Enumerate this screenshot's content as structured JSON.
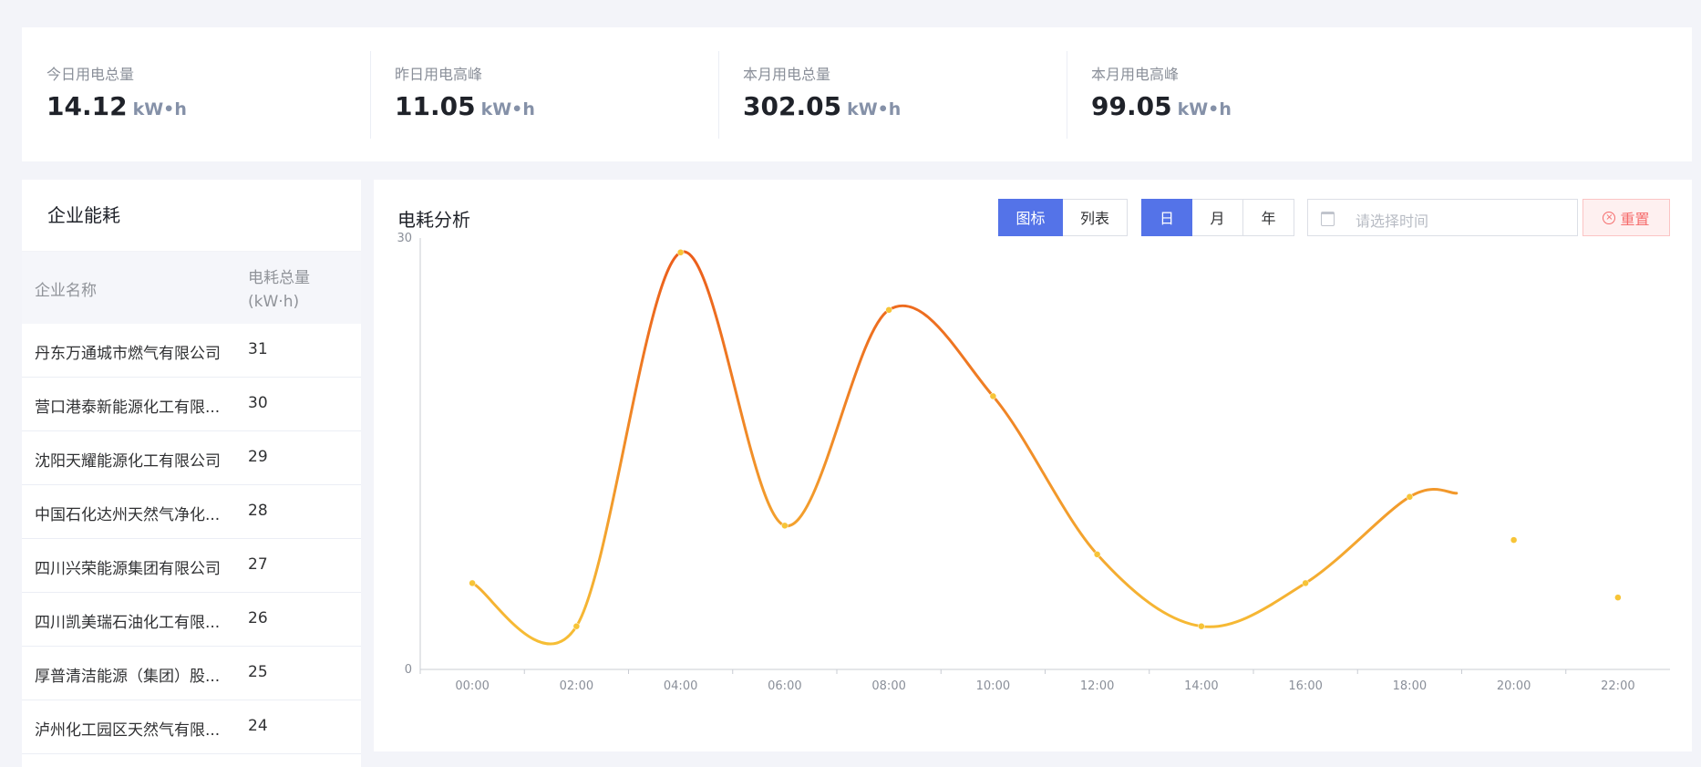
{
  "stats": [
    {
      "label": "今日用电总量",
      "value": "14.12",
      "unit": "kW•h"
    },
    {
      "label": "昨日用电高峰",
      "value": "11.05",
      "unit": "kW•h"
    },
    {
      "label": "本月用电总量",
      "value": "302.05",
      "unit": "kW•h"
    },
    {
      "label": "本月用电高峰",
      "value": "99.05",
      "unit": "kW•h"
    }
  ],
  "left_panel": {
    "title": "企业能耗",
    "columns": [
      "企业名称",
      "电耗总量(kW·h)"
    ],
    "rows": [
      {
        "name": "丹东万通城市燃气有限公司",
        "value": "31"
      },
      {
        "name": "营口港泰新能源化工有限...",
        "value": "30"
      },
      {
        "name": "沈阳天耀能源化工有限公司",
        "value": "29"
      },
      {
        "name": "中国石化达州天然气净化...",
        "value": "28"
      },
      {
        "name": "四川兴荣能源集团有限公司",
        "value": "27"
      },
      {
        "name": "四川凯美瑞石油化工有限...",
        "value": "26"
      },
      {
        "name": "厚普清洁能源（集团）股...",
        "value": "25"
      },
      {
        "name": "泸州化工园区天然气有限...",
        "value": "24"
      }
    ]
  },
  "chart_panel": {
    "title": "电耗分析",
    "view_toggle": [
      {
        "label": "图标",
        "active": true
      },
      {
        "label": "列表",
        "active": false
      }
    ],
    "period_toggle": [
      {
        "label": "日",
        "active": true
      },
      {
        "label": "月",
        "active": false
      },
      {
        "label": "年",
        "active": false
      }
    ],
    "date_placeholder": "请选择时间",
    "reset_label": "重置"
  },
  "chart_data": {
    "type": "line",
    "x": [
      "00:00",
      "02:00",
      "04:00",
      "06:00",
      "08:00",
      "10:00",
      "12:00",
      "14:00",
      "16:00",
      "18:00",
      "20:00",
      "22:00"
    ],
    "series": [
      {
        "values": [
          6,
          3,
          29,
          10,
          25,
          19,
          8,
          3,
          6,
          12,
          9,
          5
        ]
      }
    ],
    "ylim": [
      0,
      30
    ],
    "yticks": [
      0,
      30
    ],
    "curve_ends_after_index": 9,
    "colors": {
      "low": "#f7c437",
      "high": "#eb5a1a",
      "axis": "#c9ccd3"
    }
  }
}
